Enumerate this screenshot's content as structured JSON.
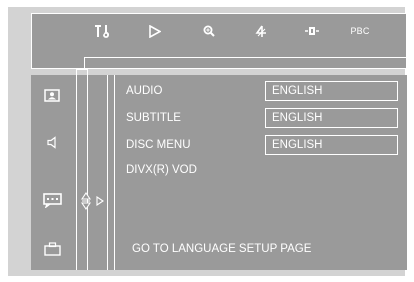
{
  "top_icons": [
    {
      "name": "general-setup-icon"
    },
    {
      "name": "video-setup-icon"
    },
    {
      "name": "zoom-icon"
    },
    {
      "name": "audio-off-icon"
    },
    {
      "name": "dolby-icon"
    },
    {
      "name": "pbc-text",
      "label": "PBC"
    }
  ],
  "side_icons": [
    {
      "name": "video-display-icon"
    },
    {
      "name": "speaker-icon"
    },
    {
      "name": "language-icon",
      "selected": true
    },
    {
      "name": "preferences-icon"
    }
  ],
  "menu": {
    "items": [
      {
        "label": "AUDIO",
        "value": "ENGLISH"
      },
      {
        "label": "SUBTITLE",
        "value": "ENGLISH"
      },
      {
        "label": "DISC MENU",
        "value": "ENGLISH"
      },
      {
        "label": "DIVX(R) VOD"
      }
    ],
    "footer": "GO TO LANGUAGE SETUP PAGE"
  },
  "colors": {
    "panel": "#9a9a9a",
    "background": "#d3d3d3",
    "foreground": "#ffffff"
  }
}
